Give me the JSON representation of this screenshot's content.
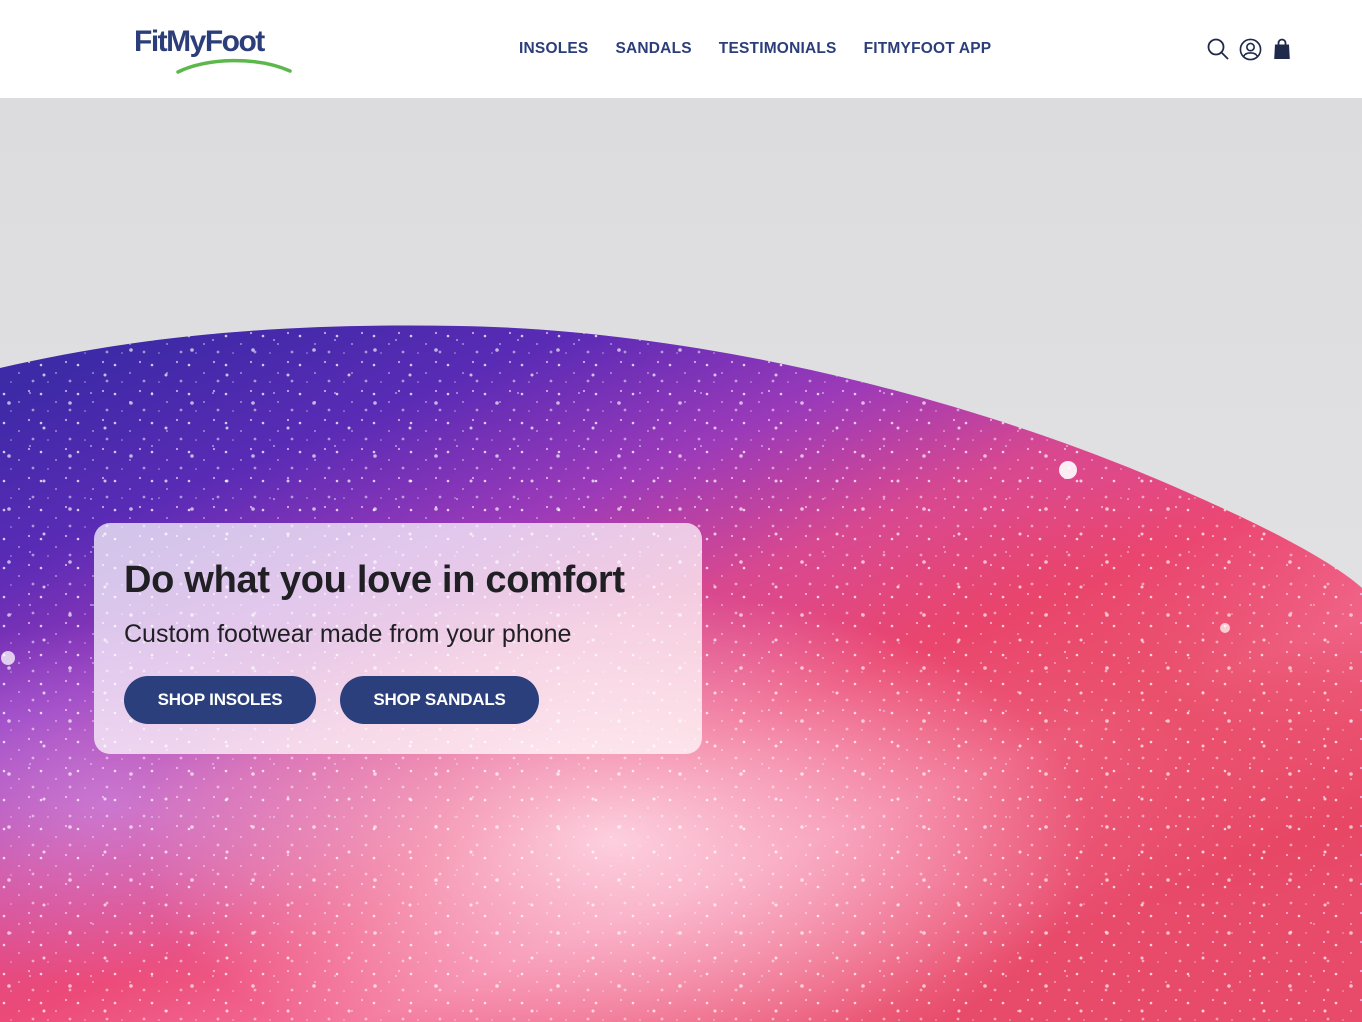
{
  "brand": {
    "name": "FitMyFoot",
    "text_color": "#2c3e7a",
    "swoosh_color": "#5cb84a"
  },
  "nav": {
    "items": [
      {
        "label": "INSOLES"
      },
      {
        "label": "SANDALS"
      },
      {
        "label": "TESTIMONIALS"
      },
      {
        "label": "FITMYFOOT APP"
      }
    ]
  },
  "header_icons": [
    "search-icon",
    "account-icon",
    "cart-icon"
  ],
  "hero": {
    "title": "Do what you love in comfort",
    "subtitle": "Custom footwear made from your phone",
    "buttons": {
      "insoles": "SHOP INSOLES",
      "sandals": "SHOP SANDALS"
    },
    "button_color": "#2b3f7c",
    "background_color": "#e2e2e4"
  }
}
